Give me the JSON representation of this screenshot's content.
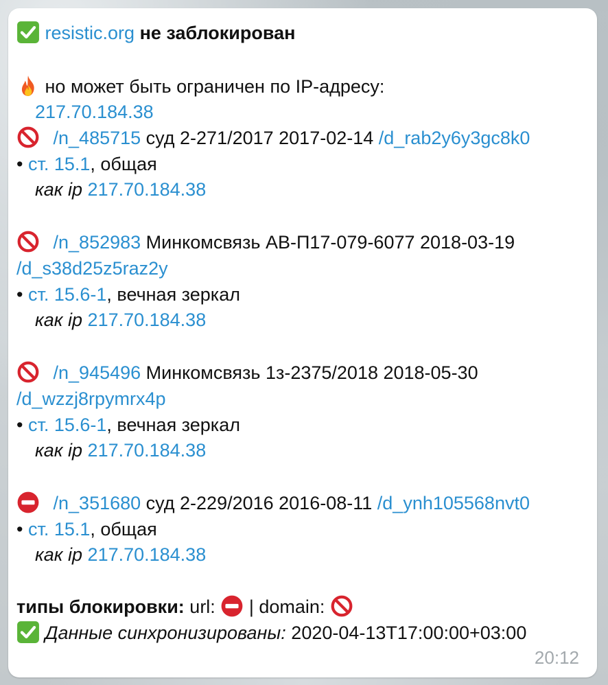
{
  "header": {
    "domain_link": "resistic.org",
    "status": "не заблокирован"
  },
  "ip_warning": {
    "text": "но может быть ограничен по IP-адресу:",
    "ip": "217.70.184.38"
  },
  "entries": [
    {
      "type": "domain",
      "n_link": "/n_485715",
      "desc": "суд 2-271/2017 2017-02-14",
      "d_link": "/d_rab2y6y3gc8k0",
      "article": "ст. 15.1",
      "category": ", общая",
      "as_ip_label": "как ip",
      "ip": "217.70.184.38"
    },
    {
      "type": "domain",
      "n_link": "/n_852983",
      "desc": "Минкомсвязь АВ-П17-079-6077 2018-03-19",
      "d_link": "/d_s38d25z5raz2y",
      "article": "ст. 15.6-1",
      "category": ", вечная зеркал",
      "as_ip_label": "как ip",
      "ip": "217.70.184.38"
    },
    {
      "type": "domain",
      "n_link": "/n_945496",
      "desc": "Минкомсвязь 1з-2375/2018 2018-05-30",
      "d_link": "/d_wzzj8rpymrx4p",
      "article": "ст. 15.6-1",
      "category": ", вечная зеркал",
      "as_ip_label": "как ip",
      "ip": "217.70.184.38"
    },
    {
      "type": "url",
      "n_link": "/n_351680",
      "desc": "суд 2-229/2016 2016-08-11",
      "d_link": "/d_ynh105568nvt0",
      "article": "ст. 15.1",
      "category": ", общая",
      "as_ip_label": "как ip",
      "ip": "217.70.184.38"
    }
  ],
  "legend": {
    "label": "типы блокировки:",
    "url": "url:",
    "separator": "|",
    "domain": "domain:"
  },
  "sync": {
    "label": "Данные синхронизированы:",
    "value": "2020-04-13T17:00:00+03:00"
  },
  "time": "20:12",
  "icons": {
    "check": "check-mark-button-icon",
    "fire": "fire-icon",
    "prohibited": "prohibited-icon",
    "no_entry": "no-entry-icon"
  },
  "colors": {
    "link": "#2a8fd0",
    "check_green": "#5ab438",
    "prohibited_red": "#d8242e",
    "time_gray": "#a3a9ad"
  }
}
